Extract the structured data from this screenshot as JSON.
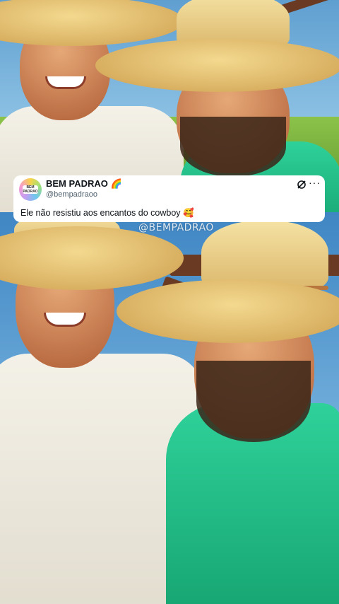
{
  "tweet": {
    "display_name": "BEM PADRAO 🌈",
    "handle": "@bempadraoo",
    "text": "Ele não resistiu aos encantos do cowboy 🥰",
    "avatar_label": "BEM PADRAO",
    "grok_icon": "grok-icon",
    "more_icon": "more-options-icon"
  },
  "watermark": "@BEMPADRAO",
  "colors": {
    "card_bg": "#ffffff",
    "green_shirt": "#1fc08a",
    "hat": "#e2bd72"
  }
}
